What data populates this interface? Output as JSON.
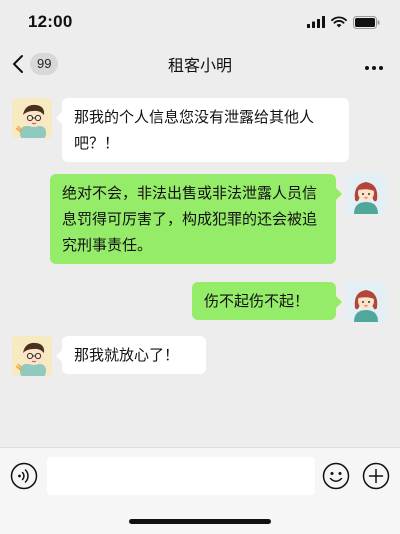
{
  "status_bar": {
    "time": "12:00"
  },
  "nav": {
    "back_badge": "99",
    "title": "租客小明"
  },
  "messages": [
    {
      "side": "left",
      "sender": "租客小明",
      "text": "那我的个人信息您没有泄露给其他人吧？！"
    },
    {
      "side": "right",
      "sender": "me",
      "text": "绝对不会，非法出售或非法泄露人员信息罚得可厉害了，构成犯罪的还会被追究刑事责任。"
    },
    {
      "side": "right",
      "sender": "me",
      "text": "伤不起伤不起！"
    },
    {
      "side": "left",
      "sender": "租客小明",
      "text": "那我就放心了！"
    }
  ],
  "input": {
    "value": ""
  },
  "colors": {
    "background": "#ededed",
    "bubble_self": "#95ec69",
    "bubble_other": "#ffffff"
  },
  "icons": [
    "back-chevron-icon",
    "more-icon",
    "voice-icon",
    "emoji-icon",
    "plus-icon",
    "signal-icon",
    "wifi-icon",
    "battery-icon"
  ]
}
